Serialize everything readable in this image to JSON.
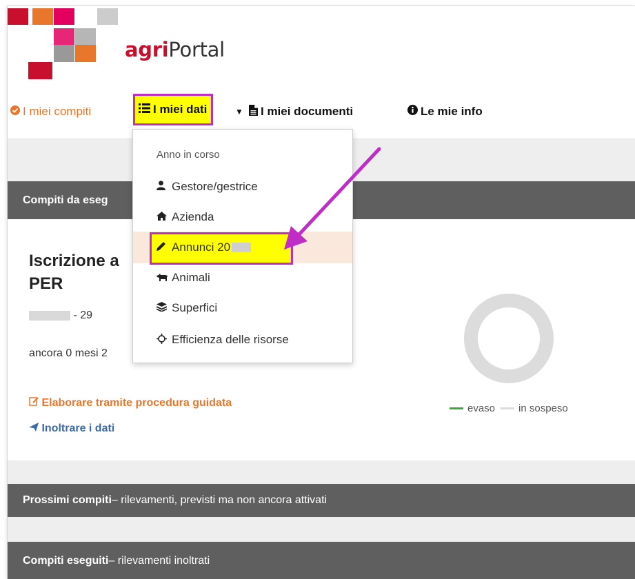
{
  "brand": {
    "name_bold": "agri",
    "name_rest": "Portal",
    "logo_colors": [
      "#c8102e",
      "#e8762b",
      "#e3005f",
      "#999999",
      "#cccccc"
    ]
  },
  "nav": {
    "items": [
      {
        "label": "I miei compiti",
        "icon": "check-circle-icon"
      },
      {
        "label": "I miei dati",
        "icon": "list-icon"
      },
      {
        "label": "I miei documenti",
        "icon": "document-icon"
      },
      {
        "label": "Le mie info",
        "icon": "info-icon"
      }
    ],
    "accent_color": "#e8762b",
    "highlight_color": "#ffff00",
    "highlight_border": "#c02cc6"
  },
  "dropdown": {
    "header": "Anno in corso",
    "items": [
      {
        "label": "Gestore/gestrice",
        "icon": "user-icon"
      },
      {
        "label": "Azienda",
        "icon": "home-icon"
      },
      {
        "label": "Annunci 20",
        "icon": "pencil-icon"
      },
      {
        "label": "Animali",
        "icon": "cow-icon"
      },
      {
        "label": "Superfici",
        "icon": "layers-icon"
      },
      {
        "label": "Efficienza delle risorse",
        "icon": "crosshair-icon"
      }
    ]
  },
  "sections": {
    "todo_title": "Compiti da eseg",
    "next_title_bold": "Prossimi compiti",
    "next_title_rest": " – rilevamenti, previsti ma non ancora attivati",
    "done_title_bold": "Compiti eseguiti",
    "done_title_rest": " – rilevamenti inoltrati"
  },
  "task": {
    "title_line1": "Iscrizione a",
    "title_line2": "PER",
    "dates": " - 29",
    "remaining": "ancora 0 mesi 2",
    "action_wizard": "Elaborare tramite procedura guidata",
    "action_send": "Inoltrare i dati"
  },
  "legend": {
    "done": "evaso",
    "pending": "in sospeso",
    "done_color": "#3aaa35",
    "pending_color": "#dcdcdc"
  }
}
